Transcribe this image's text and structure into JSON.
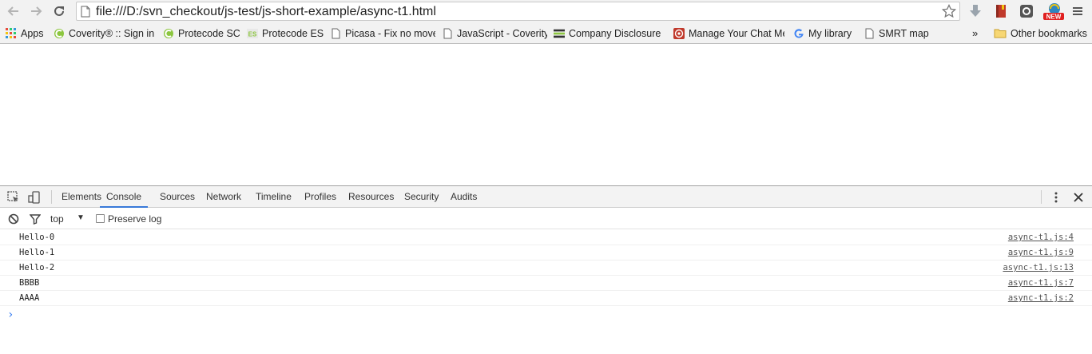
{
  "browser": {
    "url": "file:///D:/svn_checkout/js-test/js-short-example/async-t1.html",
    "buttons": {
      "back": "back-arrow-icon",
      "forward": "forward-arrow-icon",
      "reload": "reload-icon",
      "bookmark_star": "star-icon",
      "menu": "hamburger-menu-icon"
    },
    "extensions": [
      "download-arrow-icon",
      "red-book-icon",
      "gray-extension-icon",
      "new-badge-extension-icon"
    ],
    "new_badge": "NEW"
  },
  "bookmarks": {
    "items": [
      {
        "label": "Apps",
        "icon": "apps-grid-icon"
      },
      {
        "label": "Coverity® :: Sign in",
        "icon": "coverity-icon"
      },
      {
        "label": "Protecode SC",
        "icon": "protecode-icon"
      },
      {
        "label": "Protecode ES",
        "icon": "protecode-es-icon"
      },
      {
        "label": "Picasa - Fix no move",
        "icon": "page-icon"
      },
      {
        "label": "JavaScript - Coverity",
        "icon": "page-icon"
      },
      {
        "label": "Company Disclosure &",
        "icon": "stripes-icon"
      },
      {
        "label": "Manage Your Chat Me",
        "icon": "target-icon"
      },
      {
        "label": "My library",
        "icon": "google-icon"
      },
      {
        "label": "SMRT map",
        "icon": "page-icon"
      }
    ],
    "overflow": "»",
    "other": "Other bookmarks"
  },
  "devtools": {
    "tabs": [
      "Elements",
      "Console",
      "Sources",
      "Network",
      "Timeline",
      "Profiles",
      "Resources",
      "Security",
      "Audits"
    ],
    "active_tab": "Console",
    "context": "top",
    "preserve_log": "Preserve log",
    "logs": [
      {
        "message": "Hello-0",
        "source": "async-t1.js:4"
      },
      {
        "message": "Hello-1",
        "source": "async-t1.js:9"
      },
      {
        "message": "Hello-2",
        "source": "async-t1.js:13"
      },
      {
        "message": "BBBB",
        "source": "async-t1.js:7"
      },
      {
        "message": "AAAA",
        "source": "async-t1.js:2"
      }
    ],
    "prompt": "›"
  },
  "colors": {
    "accent": "#3879d9",
    "prompt": "#367cf1",
    "chrome_bg": "#f2f2f2"
  }
}
